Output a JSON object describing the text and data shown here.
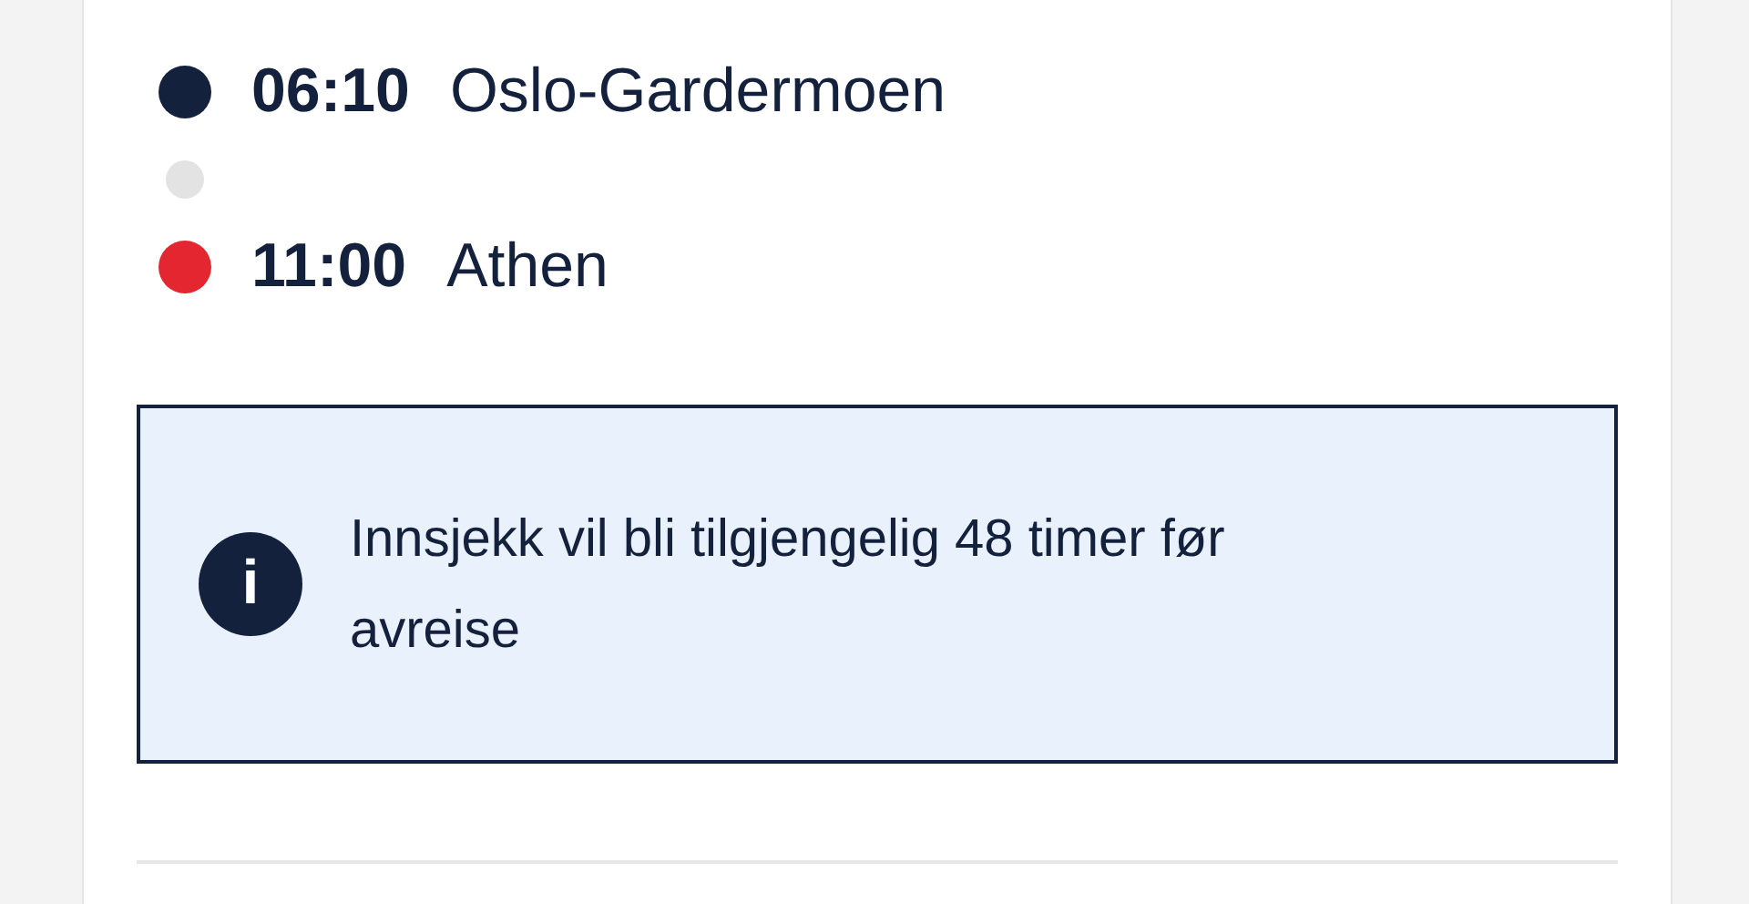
{
  "stops": [
    {
      "time": "06:10",
      "place": "Oslo-Gardermoen",
      "color": "#14213d"
    },
    {
      "time": "11:00",
      "place": "Athen",
      "color": "#e3262f"
    }
  ],
  "notice": {
    "text": "Innsjekk vil bli tilgjengelig 48 timer før avreise",
    "icon": "i"
  }
}
